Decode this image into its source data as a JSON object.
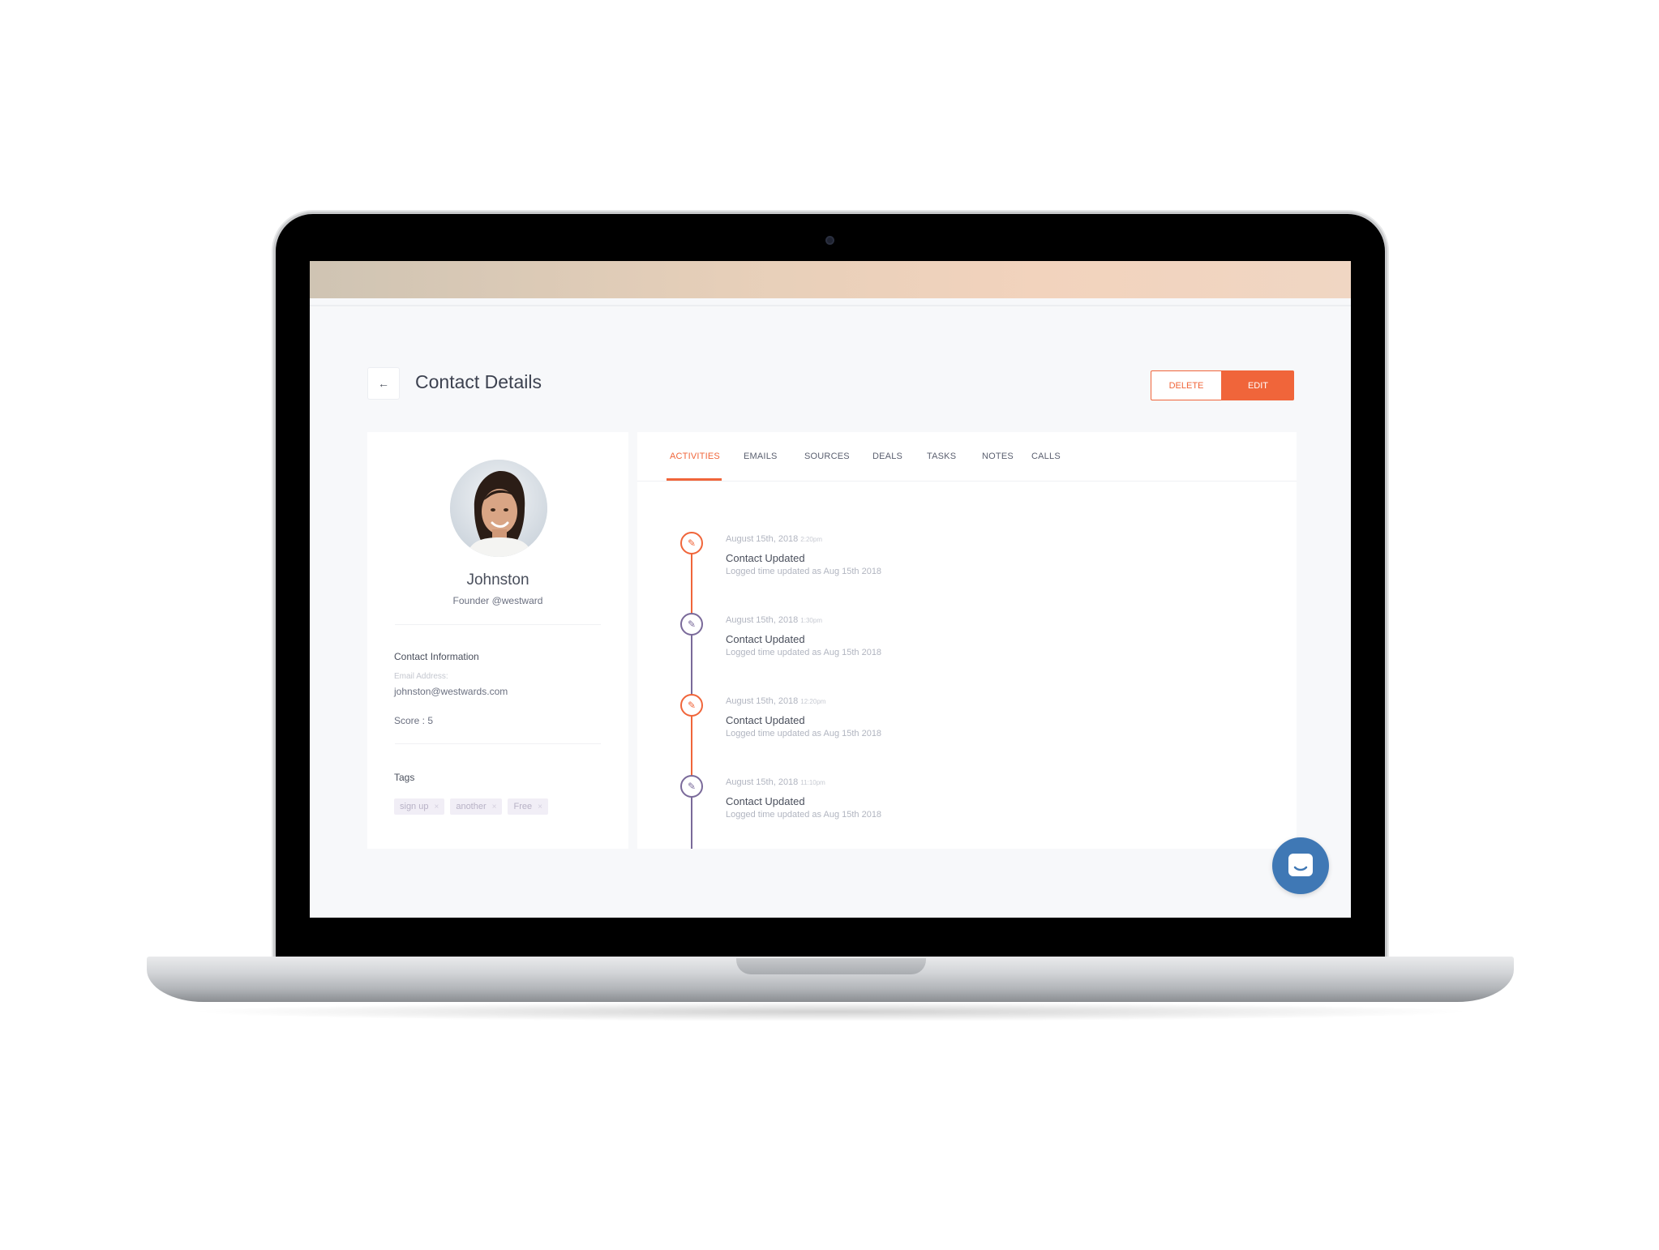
{
  "page": {
    "title": "Contact Details",
    "back_icon": "arrow-left-icon",
    "actions": {
      "delete_label": "DELETE",
      "edit_label": "EDIT"
    }
  },
  "profile": {
    "name": "Johnston",
    "role": "Founder @westward",
    "contact_info_title": "Contact Information",
    "email_label": "Email Address:",
    "email": "johnston@westwards.com",
    "score": "Score : 5",
    "tags_title": "Tags",
    "tags": [
      {
        "label": "sign up",
        "remove": "×"
      },
      {
        "label": "another",
        "remove": "×"
      },
      {
        "label": "Free",
        "remove": "×"
      }
    ]
  },
  "tabs": [
    "ACTIVITIES",
    "EMAILS",
    "SOURCES",
    "DEALS",
    "TASKS",
    "NOTES",
    "CALLS"
  ],
  "active_tab": "ACTIVITIES",
  "activities": [
    {
      "date": "August 15th, 2018",
      "time": "2:20pm",
      "title": "Contact Updated",
      "desc": "Logged time updated as Aug 15th 2018",
      "color": "#f0653a"
    },
    {
      "date": "August 15th, 2018",
      "time": "1:30pm",
      "title": "Contact Updated",
      "desc": "Logged time updated as Aug 15th 2018",
      "color": "#7a6a9a"
    },
    {
      "date": "August 15th, 2018",
      "time": "12:20pm",
      "title": "Contact Updated",
      "desc": "Logged time updated as Aug 15th 2018",
      "color": "#f0653a"
    },
    {
      "date": "August 15th, 2018",
      "time": "11:10pm",
      "title": "Contact Updated",
      "desc": "Logged time updated as Aug 15th 2018",
      "color": "#7a6a9a"
    }
  ],
  "colors": {
    "accent": "#f0653a",
    "chat": "#3f78b5",
    "timeline_secondary": "#7a6a9a"
  },
  "icons": {
    "activity": "pencil-icon",
    "chat": "chat-bubble-icon"
  }
}
